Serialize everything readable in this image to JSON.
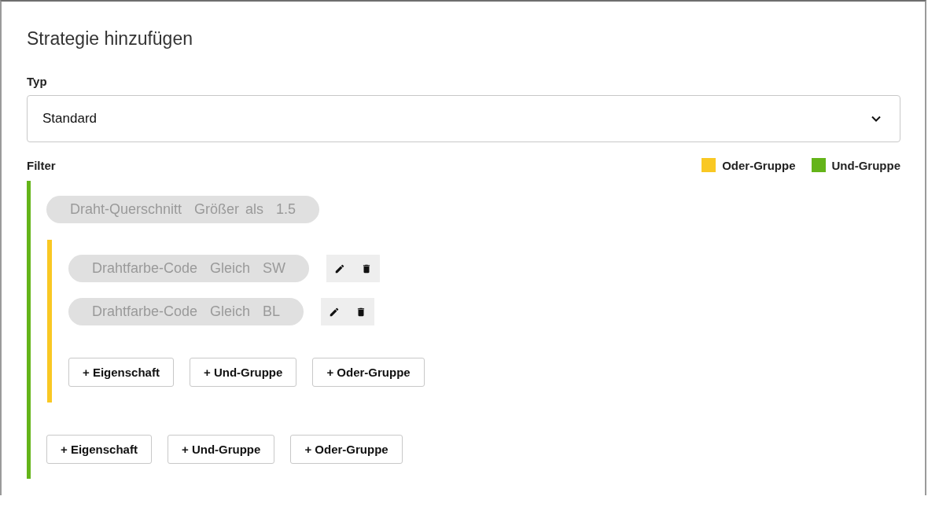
{
  "dialog": {
    "title": "Strategie hinzufügen"
  },
  "type_field": {
    "label": "Typ",
    "value": "Standard"
  },
  "filter": {
    "label": "Filter",
    "legend": [
      {
        "kind": "or",
        "label": "Oder-Gruppe",
        "color": "#f9c823"
      },
      {
        "kind": "and",
        "label": "Und-Gruppe",
        "color": "#64b419"
      }
    ],
    "group": {
      "kind": "and",
      "items": [
        {
          "kind": "condition",
          "field": "Draht-Querschnitt",
          "operator": "Größer als",
          "value": "1.5",
          "actions": false
        },
        {
          "kind": "group",
          "group": {
            "kind": "or",
            "items": [
              {
                "kind": "condition",
                "field": "Drahtfarbe-Code",
                "operator": "Gleich",
                "value": "SW",
                "actions": true
              },
              {
                "kind": "condition",
                "field": "Drahtfarbe-Code",
                "operator": "Gleich",
                "value": "BL",
                "actions": true
              }
            ],
            "buttons": [
              "+ Eigenschaft",
              "+ Und-Gruppe",
              "+ Oder-Gruppe"
            ]
          }
        }
      ],
      "buttons": [
        "+ Eigenschaft",
        "+ Und-Gruppe",
        "+ Oder-Gruppe"
      ]
    }
  }
}
